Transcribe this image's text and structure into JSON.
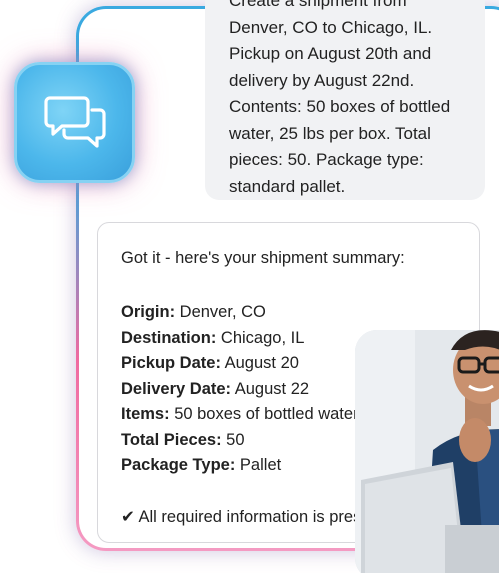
{
  "user_message": {
    "lines": [
      "Create a shipment from",
      "Denver, CO to Chicago, IL.",
      "Pickup on August 20th and",
      "delivery by August 22nd.",
      "Contents: 50 boxes of bottled",
      "water, 25 lbs per box. Total",
      "pieces: 50. Package type:",
      "standard pallet."
    ]
  },
  "summary": {
    "intro": "Got it - here's your shipment summary:",
    "fields": [
      {
        "label": "Origin:",
        "value": " Denver, CO"
      },
      {
        "label": "Destination:",
        "value": " Chicago, IL"
      },
      {
        "label": "Pickup Date:",
        "value": " August 20"
      },
      {
        "label": "Delivery Date:",
        "value": " August 22"
      },
      {
        "label": "Items:",
        "value": " 50 boxes of bottled water"
      },
      {
        "label": "Total Pieces:",
        "value": " 50"
      },
      {
        "label": "Package Type:",
        "value": " Pallet"
      }
    ],
    "status": "✔ All required information is present"
  },
  "colors": {
    "accent_blue": "#3aa9e0",
    "accent_pink": "#f06aa0",
    "text": "#222222",
    "bubble_bg": "#f1f2f4"
  },
  "icons": {
    "chat": "chat-bubbles-icon"
  }
}
